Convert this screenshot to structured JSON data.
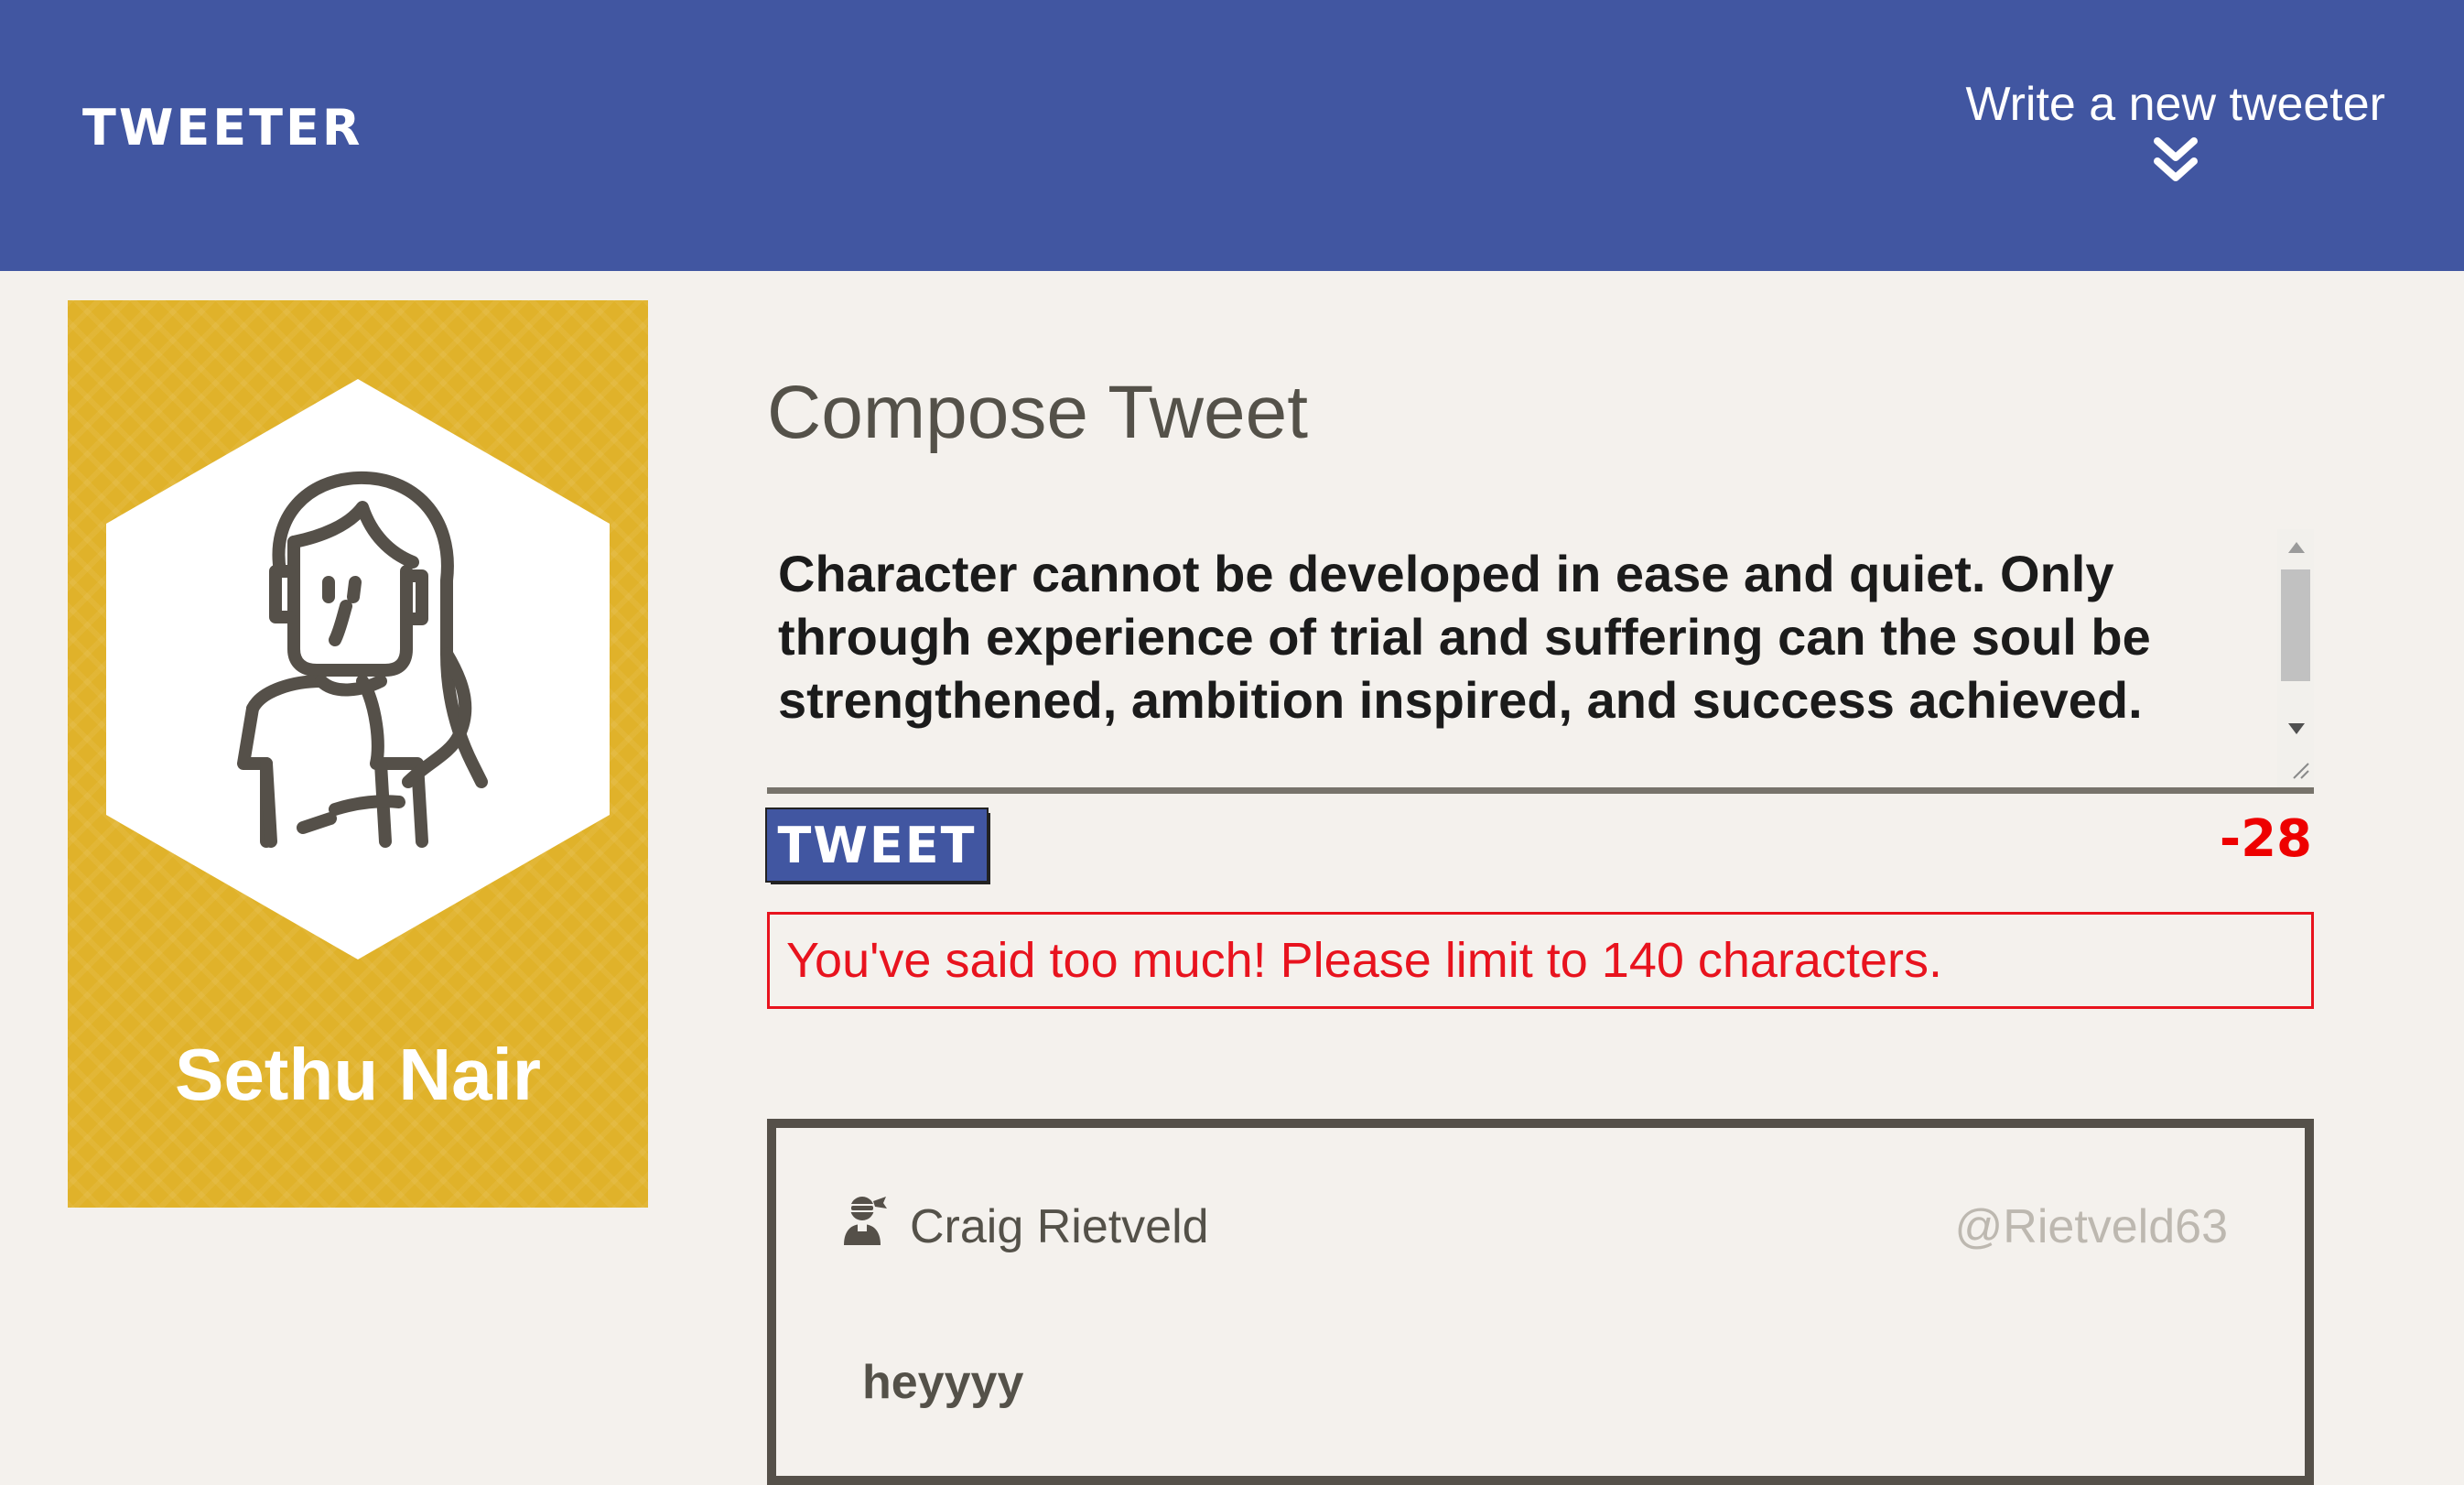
{
  "header": {
    "brand": "TWEETER",
    "compose_toggle_label": "Write a new tweeter",
    "toggle_icon": "double-chevron-down-icon"
  },
  "profile": {
    "name": "Sethu Nair",
    "avatar_icon": "user-avatar-icon"
  },
  "compose": {
    "title": "Compose Tweet",
    "text": "Character cannot be developed in ease and quiet. Only through experience of trial and suffering can the soul be strengthened, ambition inspired, and success achieved.",
    "submit_label": "TWEET",
    "counter": "-28",
    "error": "You've said too much! Please limit to 140 characters."
  },
  "tweets": [
    {
      "author": "Craig Rietveld",
      "handle": "@Rietveld63",
      "content": "heyyyy",
      "avatar_icon": "user-ninja-icon"
    }
  ],
  "colors": {
    "header_bg": "#4156a1",
    "page_bg": "#f4f1ed",
    "card_bg": "#e0b22a",
    "error": "#e8131e",
    "text_dark": "#545149"
  }
}
